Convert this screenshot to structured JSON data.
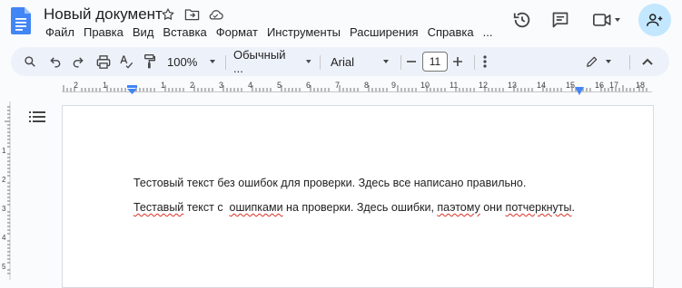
{
  "header": {
    "title": "Новый документ",
    "menus": [
      "Файл",
      "Правка",
      "Вид",
      "Вставка",
      "Формат",
      "Инструменты",
      "Расширения",
      "Справка",
      "..."
    ]
  },
  "toolbar": {
    "zoom": "100%",
    "style": "Обычный ...",
    "font": "Arial",
    "font_size": "11"
  },
  "ruler": {
    "numbers": [
      "2",
      "1",
      "1",
      "2",
      "3",
      "4",
      "5",
      "6",
      "7",
      "8",
      "9",
      "10",
      "11",
      "12",
      "13",
      "14",
      "15",
      "16",
      "17",
      "18"
    ]
  },
  "document": {
    "line1": "Тестовый текст без ошибок для проверки. Здесь все написано правильно.",
    "line2": [
      {
        "text": "Теставый",
        "error": true
      },
      {
        "text": " текст с  ",
        "error": false
      },
      {
        "text": "ошипками",
        "error": true
      },
      {
        "text": " на проверки. Здесь ошибки, ",
        "error": false
      },
      {
        "text": "паэтому",
        "error": true
      },
      {
        "text": " они ",
        "error": false
      },
      {
        "text": "потчеркнуты",
        "error": true
      },
      {
        "text": ".",
        "error": false
      }
    ]
  },
  "colors": {
    "brand_blue": "#4285f4",
    "toolbar_bg": "#edf2fa",
    "avatar_bg": "#c2e7ff",
    "spell_error": "#d93025"
  }
}
